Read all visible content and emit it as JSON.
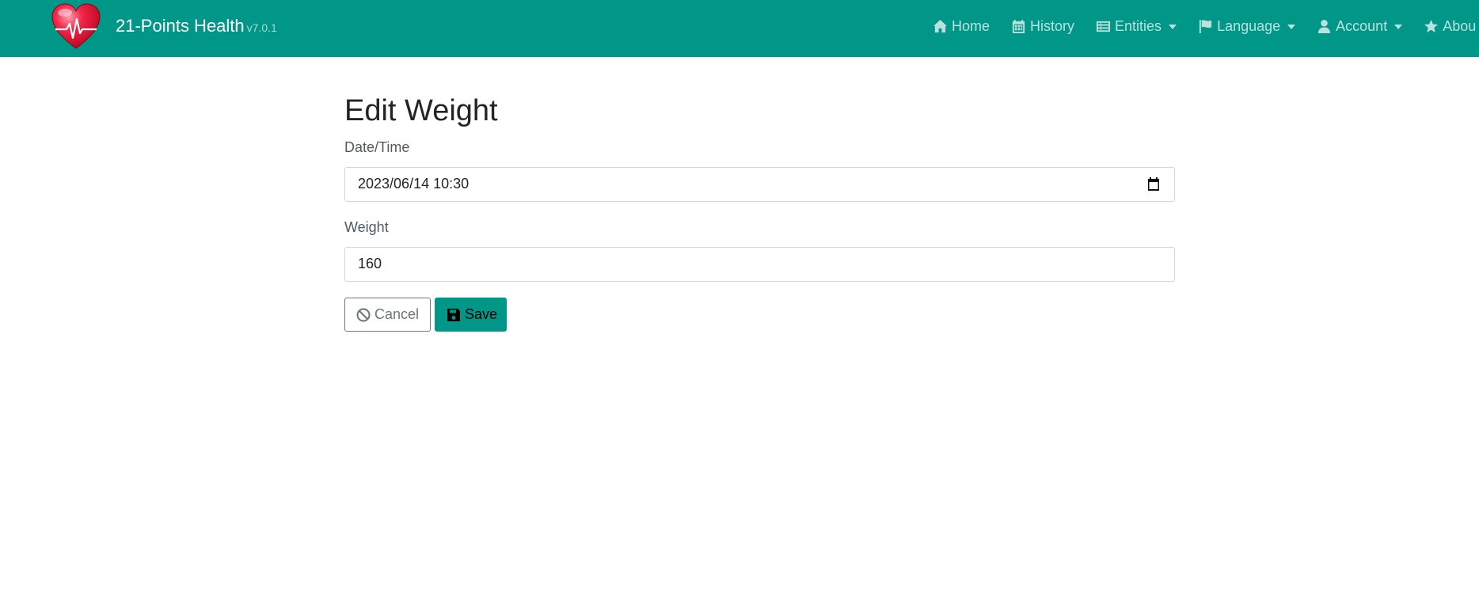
{
  "brand": {
    "title": "21-Points Health",
    "version": "v7.0.1",
    "logo_icon": "heart-pulse-logo"
  },
  "nav": {
    "items": [
      {
        "label": "Home",
        "icon": "home-icon",
        "dropdown": false
      },
      {
        "label": "History",
        "icon": "calendar-icon",
        "dropdown": false
      },
      {
        "label": "Entities",
        "icon": "table-list-icon",
        "dropdown": true
      },
      {
        "label": "Language",
        "icon": "flag-icon",
        "dropdown": true
      },
      {
        "label": "Account",
        "icon": "user-icon",
        "dropdown": true
      },
      {
        "label": "Abou",
        "icon": "star-icon",
        "dropdown": false
      }
    ]
  },
  "form": {
    "title": "Edit Weight",
    "datetime_label": "Date/Time",
    "datetime_value": "2023/06/14 10:30",
    "weight_label": "Weight",
    "weight_value": "160",
    "cancel_label": "Cancel",
    "save_label": "Save"
  },
  "colors": {
    "navbar": "#009688",
    "save_button": "#009688",
    "cancel_border": "#6c757d"
  }
}
